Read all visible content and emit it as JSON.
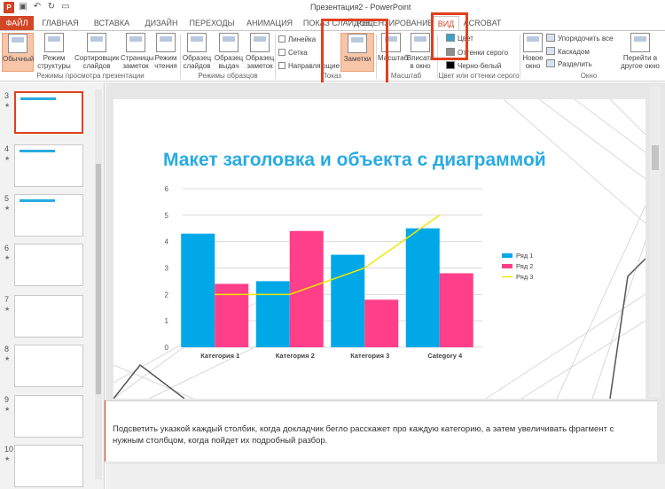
{
  "window": {
    "title": "Презентация2 - PowerPoint",
    "app_logo": "P"
  },
  "quick_access": [
    {
      "name": "save-icon",
      "glyph": "▣"
    },
    {
      "name": "undo-icon",
      "glyph": "↶"
    },
    {
      "name": "redo-icon",
      "glyph": "↻"
    },
    {
      "name": "slideshow-icon",
      "glyph": "▭"
    }
  ],
  "tabs": [
    {
      "id": "file",
      "label": "ФАЙЛ"
    },
    {
      "id": "home",
      "label": "ГЛАВНАЯ"
    },
    {
      "id": "insert",
      "label": "ВСТАВКА"
    },
    {
      "id": "design",
      "label": "ДИЗАЙН"
    },
    {
      "id": "transitions",
      "label": "ПЕРЕХОДЫ"
    },
    {
      "id": "animation",
      "label": "АНИМАЦИЯ"
    },
    {
      "id": "slideshow",
      "label": "ПОКАЗ СЛАЙДОВ"
    },
    {
      "id": "review",
      "label": "РЕЦЕНЗИРОВАНИЕ"
    },
    {
      "id": "view",
      "label": "ВИД"
    },
    {
      "id": "acrobat",
      "label": "ACROBAT"
    }
  ],
  "ribbon": {
    "presentation_views": {
      "label": "Режимы просмотра презентации",
      "buttons": [
        "Обычный",
        "Режим структуры",
        "Сортировщик слайдов",
        "Страницы заметок",
        "Режим чтения"
      ]
    },
    "master_views": {
      "label": "Режимы образцов",
      "buttons": [
        "Образец слайдов",
        "Образец выдач",
        "Образец заметок"
      ]
    },
    "show": {
      "label": "Показ",
      "checkboxes": [
        "Линейка",
        "Сетка",
        "Направляющие"
      ],
      "notes_button": "Заметки"
    },
    "zoom": {
      "label": "Масштаб",
      "buttons": [
        "Масштаб",
        "Вписать в окно"
      ]
    },
    "color": {
      "label": "Цвет или оттенки серого",
      "items": [
        "Цвет",
        "Оттенки серого",
        "Черно-белый"
      ]
    },
    "window": {
      "label": "Окно",
      "new_window": "Новое окно",
      "items": [
        "Упорядочить все",
        "Каскадом",
        "Разделить"
      ]
    },
    "switch_windows": "Перейти в другое окно"
  },
  "thumbnails": [
    {
      "num": "3",
      "star": "★",
      "active": true
    },
    {
      "num": "4",
      "star": "★",
      "active": false
    },
    {
      "num": "5",
      "star": "★",
      "active": false
    },
    {
      "num": "6",
      "star": "★",
      "active": false
    },
    {
      "num": "7",
      "star": "★",
      "active": false
    },
    {
      "num": "8",
      "star": "★",
      "active": false
    },
    {
      "num": "9",
      "star": "★",
      "active": false
    },
    {
      "num": "10",
      "star": "★",
      "active": false
    }
  ],
  "slide": {
    "title": "Макет заголовка и объекта с диаграммой"
  },
  "chart_data": {
    "type": "bar",
    "categories": [
      "Категория 1",
      "Категория 2",
      "Категория 3",
      "Category 4"
    ],
    "series": [
      {
        "name": "Ряд 1",
        "type": "bar",
        "color": "#00a8e8",
        "values": [
          4.3,
          2.5,
          3.5,
          4.5
        ]
      },
      {
        "name": "Ряд 2",
        "type": "bar",
        "color": "#ff3f8a",
        "values": [
          2.4,
          4.4,
          1.8,
          2.8
        ]
      },
      {
        "name": "Ряд 3",
        "type": "line",
        "color": "#f2e600",
        "values": [
          2.0,
          2.0,
          3.0,
          5.0
        ]
      }
    ],
    "ylim": [
      0,
      6
    ],
    "yticks": [
      "0",
      "1",
      "2",
      "3",
      "4",
      "5",
      "6"
    ],
    "grid": true,
    "legend": "right"
  },
  "notes": {
    "text": "Подсветить указкой каждый столбик, когда докладчик бегло расскажет про каждую категорию, а затем увеличивать фрагмент с нужным столбцом, когда пойдет их подробный разбор."
  },
  "colors": {
    "accent": "#d24726",
    "highlight": "#e0401e",
    "title_blue": "#29abe2"
  }
}
